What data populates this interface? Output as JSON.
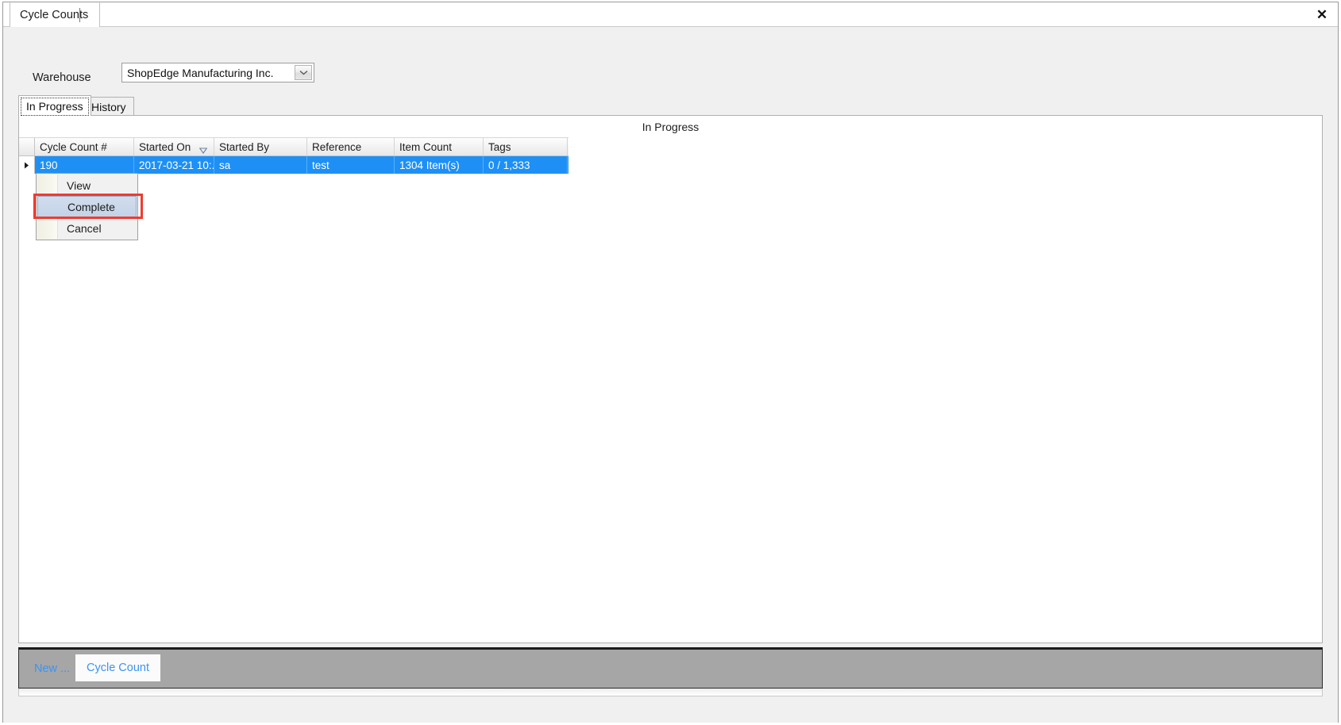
{
  "window": {
    "document_tab_label": "Cycle Counts",
    "close_icon": "close-x-icon"
  },
  "form": {
    "warehouse_label": "Warehouse",
    "warehouse_value": "ShopEdge Manufacturing Inc.",
    "dropdown_icon": "chevron-down-icon"
  },
  "tabs": [
    {
      "label": "In Progress",
      "selected": true
    },
    {
      "label": "History",
      "selected": false
    }
  ],
  "panel": {
    "title": "In Progress"
  },
  "grid": {
    "sort_icon": "sort-descending-icon",
    "row_indicator_icon": "row-arrow-icon",
    "columns": [
      "Cycle Count #",
      "Started On",
      "Started By",
      "Reference",
      "Item Count",
      "Tags"
    ],
    "sorted_column": "Started On",
    "rows": [
      {
        "cycle_count_number": "190",
        "started_on": "2017-03-21  10:...",
        "started_by": "sa",
        "reference": "test",
        "item_count": "1304 Item(s)",
        "tags": "0 / 1,333",
        "selected": true
      }
    ]
  },
  "context_menu": {
    "items": [
      {
        "label": "View",
        "highlighted": false
      },
      {
        "label": "Complete",
        "highlighted": true
      },
      {
        "label": "Cancel",
        "highlighted": false
      }
    ]
  },
  "bottom_toolbar": {
    "new_label": "New ...",
    "cycle_count_button": "Cycle Count"
  },
  "colors": {
    "selection_blue": "#1e90f5",
    "link_blue": "#3d93f0",
    "highlight_red": "#f03b30",
    "toolbar_gray": "#a6a6a6",
    "menu_highlight": "#c3d3e8"
  }
}
